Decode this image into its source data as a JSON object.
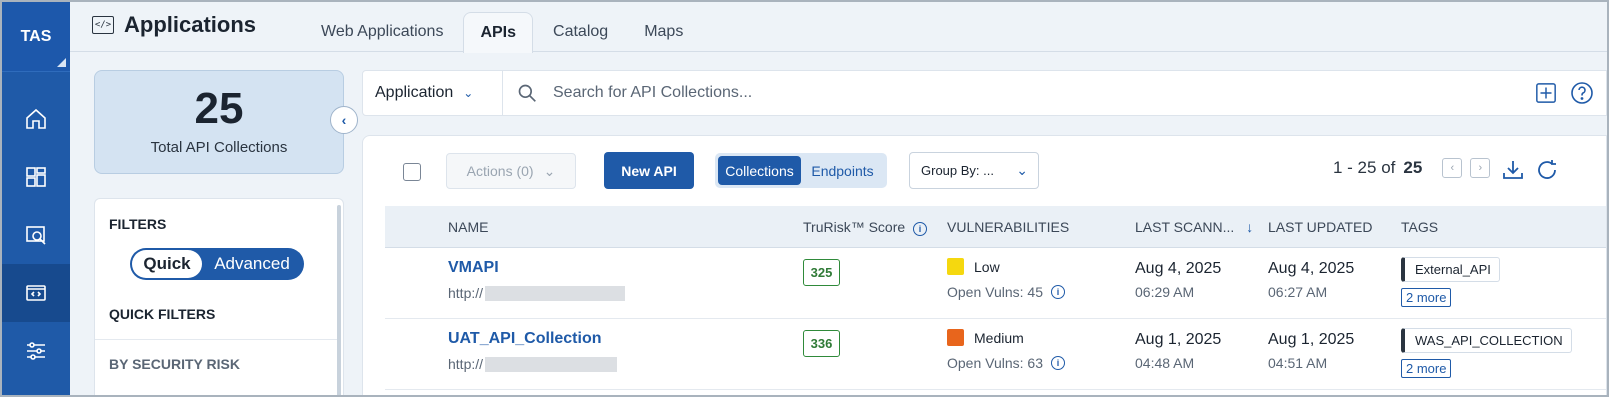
{
  "brand": "TAS",
  "app": {
    "title": "Applications"
  },
  "tabs": [
    {
      "label": "Web Applications"
    },
    {
      "label": "APIs"
    },
    {
      "label": "Catalog"
    },
    {
      "label": "Maps"
    }
  ],
  "summary": {
    "count": "25",
    "label": "Total API Collections"
  },
  "filters": {
    "heading": "FILTERS",
    "toggle_quick": "Quick",
    "toggle_advanced": "Advanced",
    "quick_filters": "QUICK FILTERS",
    "by_security_risk": "BY SECURITY RISK"
  },
  "search": {
    "scope": "Application",
    "placeholder": "Search for API Collections..."
  },
  "toolbar": {
    "actions": "Actions (0)",
    "new_api": "New API",
    "seg_collections": "Collections",
    "seg_endpoints": "Endpoints",
    "group_by": "Group By: ...",
    "pager_range": "1 - 25 of",
    "pager_total": "25"
  },
  "columns": {
    "name": "NAME",
    "trurisk": "TruRisk™ Score",
    "vulns": "VULNERABILITIES",
    "last_scanned": "LAST SCANN...",
    "last_updated": "LAST UPDATED",
    "tags": "TAGS"
  },
  "rows": [
    {
      "name": "VMAPI",
      "url_prefix": "http://",
      "score": "325",
      "severity": "Low",
      "severity_color": "#f5d80f",
      "open_vulns": "Open Vulns: 45",
      "scanned_date": "Aug 4, 2025",
      "scanned_time": "06:29 AM",
      "updated_date": "Aug 4, 2025",
      "updated_time": "06:27 AM",
      "tag": "External_API",
      "more": "2 more"
    },
    {
      "name": "UAT_API_Collection",
      "url_prefix": "http://",
      "score": "336",
      "severity": "Medium",
      "severity_color": "#e8651c",
      "open_vulns": "Open Vulns: 63",
      "scanned_date": "Aug 1, 2025",
      "scanned_time": "04:48 AM",
      "updated_date": "Aug 1, 2025",
      "updated_time": "04:51 AM",
      "tag": "WAS_API_COLLECTION",
      "more": "2 more"
    }
  ]
}
